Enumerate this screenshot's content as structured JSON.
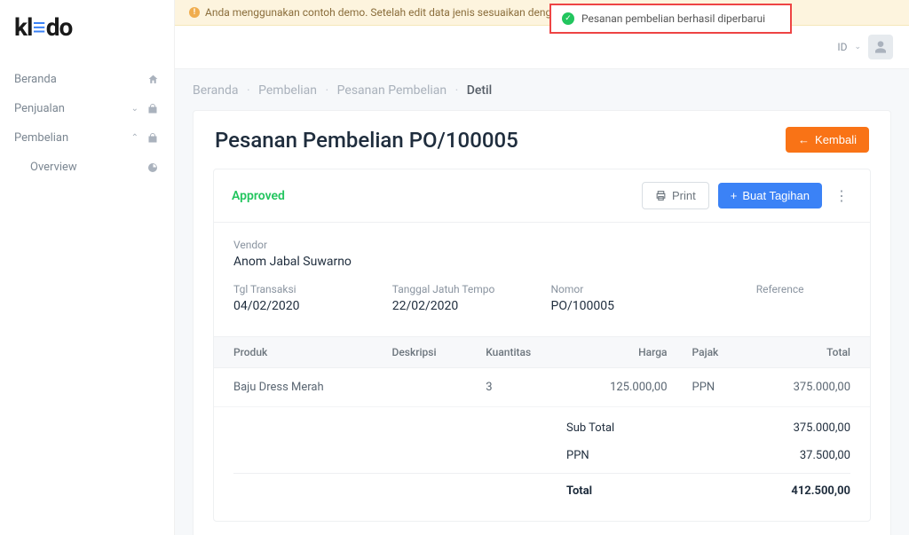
{
  "logo": {
    "pre": "kl",
    "post": "do"
  },
  "nav": {
    "beranda": "Beranda",
    "penjualan": "Penjualan",
    "pembelian": "Pembelian",
    "overview": "Overview"
  },
  "banner": "Anda menggunakan contoh demo. Setelah          edit data jenis           sesuaikan dengan perusahaan Anda",
  "toast": "Pesanan pembelian berhasil diperbarui",
  "topbar": {
    "lang": "ID"
  },
  "breadcrumb": {
    "items": [
      "Beranda",
      "Pembelian",
      "Pesanan Pembelian"
    ],
    "current": "Detil"
  },
  "page": {
    "title": "Pesanan Pembelian PO/100005",
    "back": "Kembali",
    "status": "Approved",
    "print": "Print",
    "create_bill": "Buat Tagihan"
  },
  "meta": {
    "vendor_label": "Vendor",
    "vendor": "Anom Jabal Suwarno",
    "tx_date_label": "Tgl Transaksi",
    "tx_date": "04/02/2020",
    "due_date_label": "Tanggal Jatuh Tempo",
    "due_date": "22/02/2020",
    "number_label": "Nomor",
    "number": "PO/100005",
    "reference_label": "Reference",
    "reference": ""
  },
  "table": {
    "head": {
      "product": "Produk",
      "desc": "Deskripsi",
      "qty": "Kuantitas",
      "price": "Harga",
      "tax": "Pajak",
      "total": "Total"
    },
    "rows": [
      {
        "product": "Baju Dress Merah",
        "desc": "",
        "qty": "3",
        "price": "125.000,00",
        "tax": "PPN",
        "total": "375.000,00"
      }
    ]
  },
  "totals": {
    "subtotal_label": "Sub Total",
    "subtotal": "375.000,00",
    "ppn_label": "PPN",
    "ppn": "37.500,00",
    "total_label": "Total",
    "total": "412.500,00"
  }
}
